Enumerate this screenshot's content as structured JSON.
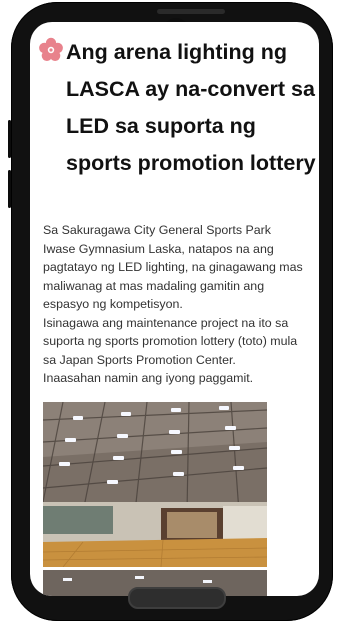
{
  "article": {
    "title": "Ang arena lighting ng LASCA ay na-convert sa LED sa suporta ng sports promotion lottery",
    "paragraphs": [
      "Sa Sakuragawa City General Sports Park Iwase Gymnasium Laska, natapos na ang pagtatayo ng LED lighting, na ginagawang mas maliwanag at mas madaling gamitin ang espasyo ng kompetisyon.",
      "Isinagawa ang maintenance project na ito sa suporta ng sports promotion lottery (toto) mula sa Japan Sports Promotion Center.",
      "Inaasahan namin ang iyong paggamit."
    ]
  },
  "icons": {
    "title_marker": "cherry-blossom-icon",
    "camera": "front-camera-icon"
  },
  "colors": {
    "accent": "#e8828c",
    "title": "#111111",
    "body": "#333333",
    "frame": "#111111"
  }
}
